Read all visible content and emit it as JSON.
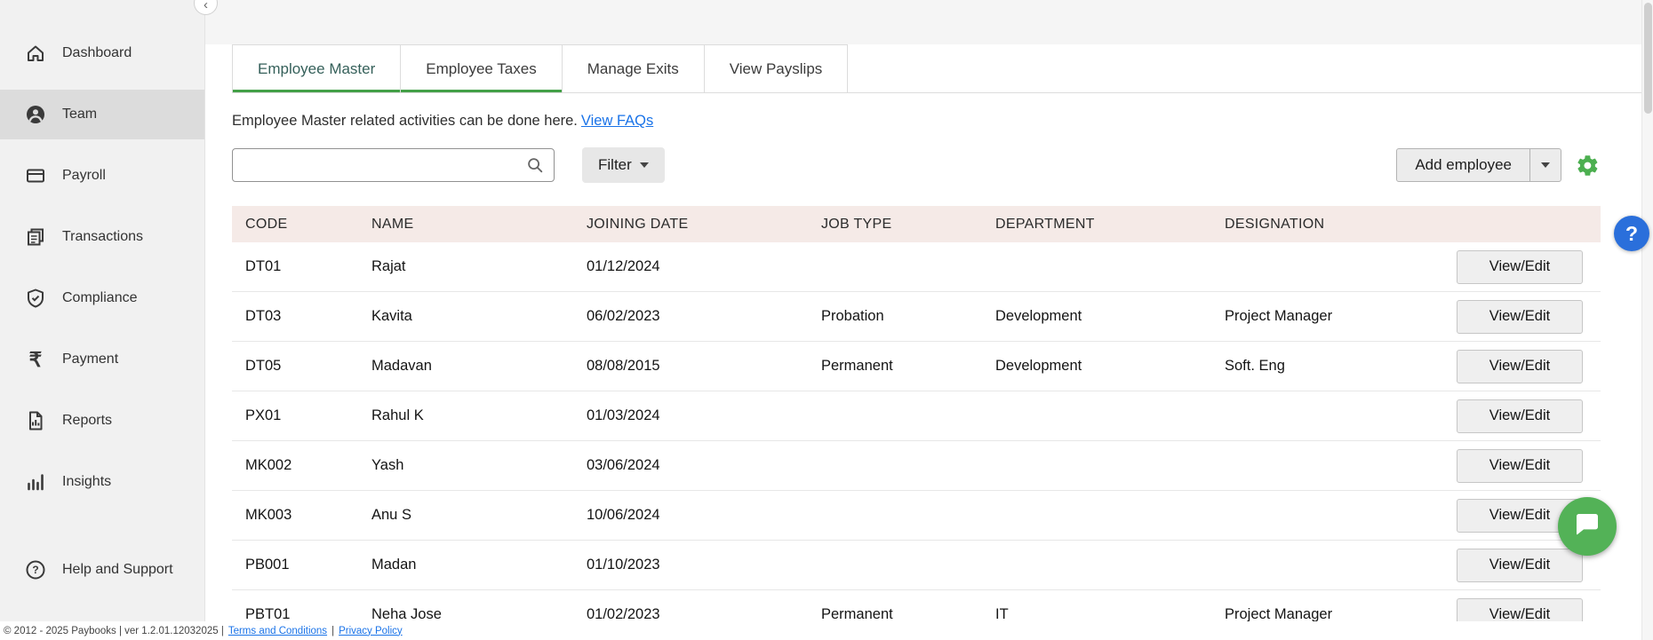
{
  "colors": {
    "accent_green": "#43a047",
    "link_blue": "#1a73e8",
    "gear_green": "#4caf50",
    "chat_green": "#53b257",
    "help_blue": "#2a6fdb",
    "table_header_bg": "#f5eae7",
    "sidebar_bg": "#f1f1f1",
    "sidebar_active_bg": "#dcdcdc",
    "active_tab_text": "#35605a"
  },
  "sidebar": {
    "items": [
      {
        "label": "Dashboard",
        "icon": "home",
        "active": false
      },
      {
        "label": "Team",
        "icon": "team",
        "active": true
      },
      {
        "label": "Payroll",
        "icon": "payroll",
        "active": false
      },
      {
        "label": "Transactions",
        "icon": "transactions",
        "active": false
      },
      {
        "label": "Compliance",
        "icon": "compliance",
        "active": false
      },
      {
        "label": "Payment",
        "icon": "payment",
        "active": false
      },
      {
        "label": "Reports",
        "icon": "reports",
        "active": false
      },
      {
        "label": "Insights",
        "icon": "insights",
        "active": false
      }
    ],
    "help_label": "Help and Support"
  },
  "tabs": [
    {
      "label": "Employee Master",
      "active": true,
      "underlined": true
    },
    {
      "label": "Employee Taxes",
      "active": false,
      "underlined": true
    },
    {
      "label": "Manage Exits",
      "active": false,
      "underlined": false
    },
    {
      "label": "View Payslips",
      "active": false,
      "underlined": false
    }
  ],
  "subheader": {
    "text": "Employee Master related activities can be done here.",
    "link_label": "View FAQs"
  },
  "toolbar": {
    "search_value": "",
    "filter_label": "Filter",
    "add_employee_label": "Add employee"
  },
  "table": {
    "headers": [
      "CODE",
      "NAME",
      "JOINING DATE",
      "JOB TYPE",
      "DEPARTMENT",
      "DESIGNATION"
    ],
    "action_label": "View/Edit",
    "rows": [
      {
        "code": "DT01",
        "name": "Rajat",
        "joining_date": "01/12/2024",
        "job_type": "",
        "department": "",
        "designation": ""
      },
      {
        "code": "DT03",
        "name": "Kavita",
        "joining_date": "06/02/2023",
        "job_type": "Probation",
        "department": "Development",
        "designation": "Project Manager"
      },
      {
        "code": "DT05",
        "name": "Madavan",
        "joining_date": "08/08/2015",
        "job_type": "Permanent",
        "department": "Development",
        "designation": "Soft. Eng"
      },
      {
        "code": "PX01",
        "name": "Rahul K",
        "joining_date": "01/03/2024",
        "job_type": "",
        "department": "",
        "designation": ""
      },
      {
        "code": "MK002",
        "name": "Yash",
        "joining_date": "03/06/2024",
        "job_type": "",
        "department": "",
        "designation": ""
      },
      {
        "code": "MK003",
        "name": "Anu S",
        "joining_date": "10/06/2024",
        "job_type": "",
        "department": "",
        "designation": ""
      },
      {
        "code": "PB001",
        "name": "Madan",
        "joining_date": "01/10/2023",
        "job_type": "",
        "department": "",
        "designation": ""
      },
      {
        "code": "PBT01",
        "name": "Neha Jose",
        "joining_date": "01/02/2023",
        "job_type": "Permanent",
        "department": "IT",
        "designation": "Project Manager"
      }
    ]
  },
  "footer": {
    "text": "© 2012 - 2025 Paybooks | ver 1.2.01.12032025 |",
    "terms_label": "Terms and Conditions",
    "divider": "|",
    "privacy_label": "Privacy Policy"
  },
  "floating": {
    "help_symbol": "?"
  }
}
